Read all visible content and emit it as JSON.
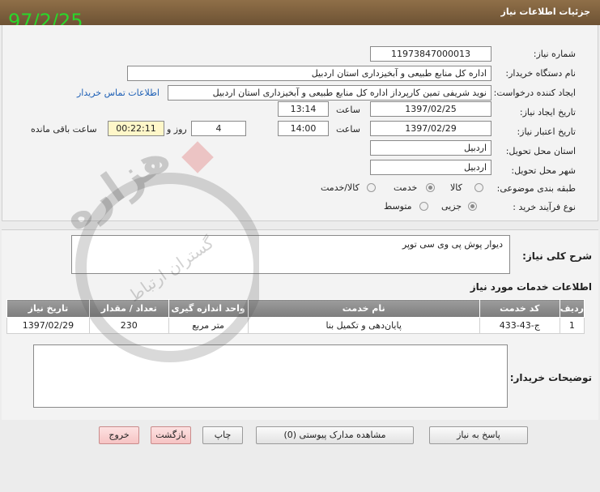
{
  "header": {
    "title": "جزئیات اطلاعات نیاز"
  },
  "corner_date": "97/2/25",
  "form": {
    "need_number_label": "شماره نیاز:",
    "need_number": "11973847000013",
    "buyer_org_label": "نام دستگاه خریدار:",
    "buyer_org": "اداره کل منابع طبیعی و آبخیزداری استان اردبیل",
    "creator_label": "ایجاد کننده درخواست:",
    "creator": "نوید شریفی تمین کارپرداز اداره کل منابع طبیعی و آبخیزداری استان اردبیل",
    "contact_link": "اطلاعات تماس خریدار",
    "created_date_label": "تاریخ ایجاد نیاز:",
    "created_date": "1397/02/25",
    "hour_label": "ساعت",
    "created_time": "13:14",
    "valid_date_label": "تاریخ اعتبار نیاز:",
    "valid_date": "1397/02/29",
    "valid_time": "14:00",
    "days": "4",
    "days_suffix": "روز و",
    "remaining_time": "00:22:11",
    "remaining_suffix": "ساعت باقی مانده",
    "province_label": "استان محل تحویل:",
    "province": "اردبیل",
    "city_label": "شهر محل تحویل:",
    "city": "اردبیل",
    "category_label": "طبقه بندی موضوعی:",
    "category_options": [
      "کالا",
      "خدمت",
      "کالا/خدمت"
    ],
    "category_selected": "خدمت",
    "process_label": "نوع فرآیند خرید :",
    "process_options": [
      "جزیی",
      "متوسط"
    ],
    "process_selected": "جزیی"
  },
  "description": {
    "label": "شرح کلی نیاز:",
    "text": "دیوار پوش پی وی سی توپر"
  },
  "services": {
    "title": "اطلاعات خدمات مورد نیاز",
    "columns": [
      "ردیف",
      "کد خدمت",
      "نام خدمت",
      "واحد اندازه گیری",
      "تعداد / مقدار",
      "تاریخ نیاز"
    ],
    "rows": [
      [
        "1",
        "ج-43-433",
        "پایان‌دهی و تکمیل بنا",
        "متر مربع",
        "230",
        "1397/02/29"
      ]
    ]
  },
  "buyer_notes": {
    "label": "توضیحات خریدار:",
    "text": ""
  },
  "buttons": {
    "reply": "پاسخ به نیاز",
    "attachments": "مشاهده مدارک پیوستی (0)",
    "print": "چاپ",
    "back": "بازگشت",
    "exit": "خروج"
  },
  "watermark": {
    "big": "هزاره",
    "small": "گستران ارتباط"
  },
  "colors": {
    "header": "#7a5c3a",
    "corner_date": "#2bd62b",
    "link": "#1d5fb5",
    "time_box": "#fff7c9",
    "table_header": "#8a8a8a"
  }
}
